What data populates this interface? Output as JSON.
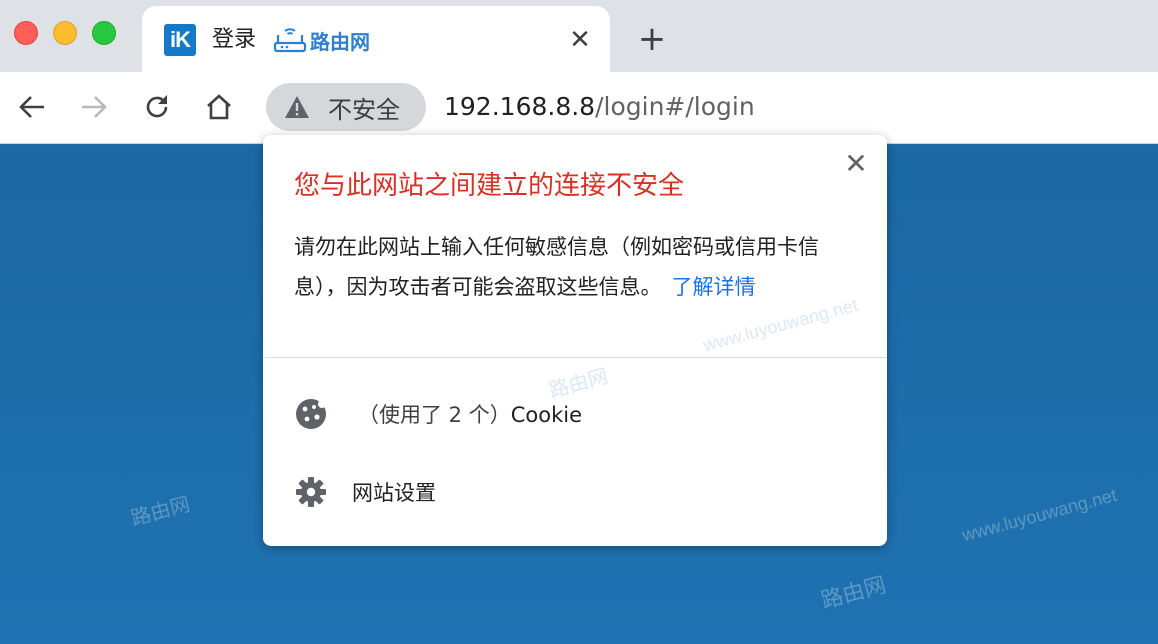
{
  "window": {
    "buttons": {
      "close": "close",
      "minimize": "minimize",
      "zoom": "zoom"
    }
  },
  "tab": {
    "favicon_text": "iK",
    "title": "登录",
    "logo_text": "路由网",
    "close_glyph": "✕"
  },
  "new_tab_glyph": "+",
  "toolbar": {
    "security_label": "不安全",
    "url_host": "192.168.8.8",
    "url_path": "/login#/login"
  },
  "popup": {
    "close_glyph": "✕",
    "title": "您与此网站之间建立的连接不安全",
    "description": "请勿在此网站上输入任何敏感信息（例如密码或信用卡信息），因为攻击者可能会盗取这些信息。",
    "learn_more": "了解详情",
    "cookies_prefix": "（使用了 2 个）",
    "cookies_label": "Cookie",
    "site_settings": "网站设置"
  },
  "watermarks": [
    "www.luyouwang.net",
    "路由网"
  ],
  "colors": {
    "title_red": "#d93025",
    "link_blue": "#1a73e8",
    "page_blue": "#1e6fa8"
  }
}
